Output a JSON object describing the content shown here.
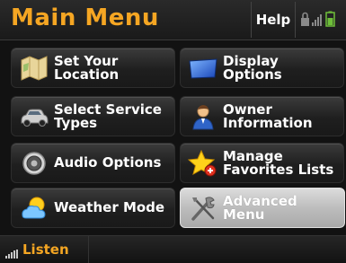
{
  "header": {
    "title": "Main Menu",
    "help_label": "Help"
  },
  "status_icons": [
    "lock-icon",
    "signal-bars-icon",
    "battery-icon"
  ],
  "menu": {
    "items": [
      {
        "label": "Set Your\nLocation",
        "icon": "map-icon"
      },
      {
        "label": "Display\nOptions",
        "icon": "display-icon"
      },
      {
        "label": "Select Service\nTypes",
        "icon": "car-icon"
      },
      {
        "label": "Owner\nInformation",
        "icon": "person-icon"
      },
      {
        "label": "Audio Options",
        "icon": "speaker-icon"
      },
      {
        "label": "Manage\nFavorites Lists",
        "icon": "star-plus-icon"
      },
      {
        "label": "Weather Mode",
        "icon": "weather-icon"
      },
      {
        "label": "Advanced\nMenu",
        "icon": "tools-icon",
        "selected": true
      }
    ]
  },
  "footer": {
    "listen_label": "Listen",
    "listen_icon": "signal-bars-icon"
  },
  "colors": {
    "accent": "#f5a623",
    "background": "#121212",
    "selected": "#c0c0c0"
  }
}
